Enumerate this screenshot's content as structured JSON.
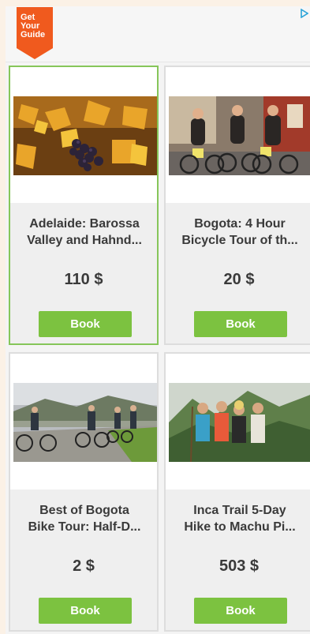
{
  "brand": {
    "logo_lines": [
      "Get",
      "Your",
      "Guide"
    ],
    "logo_color": "#f05a1e"
  },
  "colors": {
    "button_green": "#7cc240",
    "active_border": "#86c65a",
    "card_bg": "#efefef"
  },
  "tours": [
    {
      "title_line1": "Adelaide: Barossa",
      "title_line2": "Valley and Hahnd...",
      "price": "110 $",
      "book_label": "Book"
    },
    {
      "title_line1": "Bogota: 4 Hour",
      "title_line2": "Bicycle Tour of th...",
      "price": "20 $",
      "book_label": "Book"
    },
    {
      "title_line1": "Best of Bogota",
      "title_line2": "Bike Tour: Half-D...",
      "price": "2 $",
      "book_label": "Book"
    },
    {
      "title_line1": "Inca Trail 5-Day",
      "title_line2": "Hike to Machu Pi...",
      "price": "503 $",
      "book_label": "Book"
    }
  ]
}
